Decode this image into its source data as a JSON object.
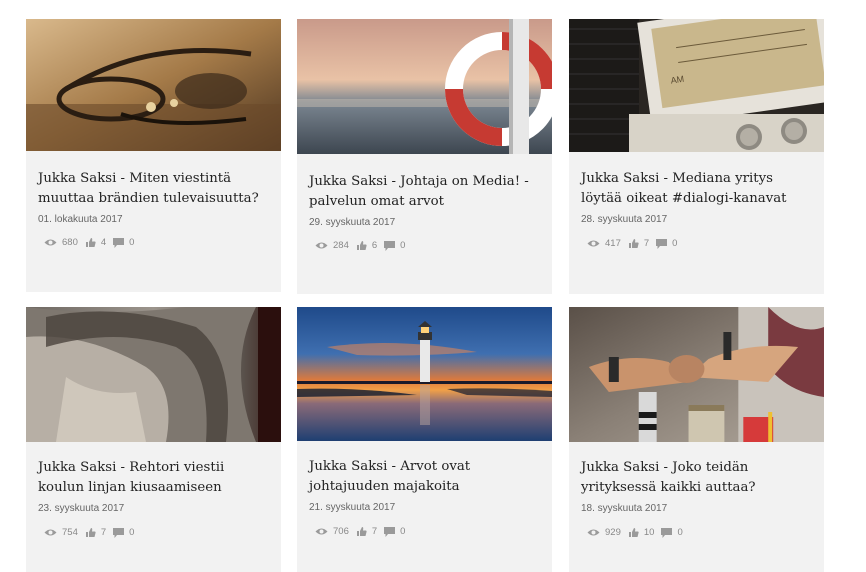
{
  "cards": [
    {
      "title": "Jukka Saksi - Miten viestintä muuttaa brändien tulevaisuutta?",
      "date": "01. lokakuuta 2017",
      "views": "680",
      "likes": "4",
      "comments": "0",
      "image": "sunglasses-photo"
    },
    {
      "title": "Jukka Saksi - Johtaja on Media! - palvelun omat arvot",
      "date": "29. syyskuuta 2017",
      "views": "284",
      "likes": "6",
      "comments": "0",
      "image": "lifebuoy-photo"
    },
    {
      "title": "Jukka Saksi - Mediana yritys löytää oikeat #dialogi-kanavat",
      "date": "28. syyskuuta 2017",
      "views": "417",
      "likes": "7",
      "comments": "0",
      "image": "radio-photo"
    },
    {
      "title": "Jukka Saksi - Rehtori viestii koulun linjan kiusaamiseen",
      "date": "23. syyskuuta 2017",
      "views": "754",
      "likes": "7",
      "comments": "0",
      "image": "sad-person-photo"
    },
    {
      "title": "Jukka Saksi - Arvot ovat johtajuuden majakoita",
      "date": "21. syyskuuta 2017",
      "views": "706",
      "likes": "7",
      "comments": "0",
      "image": "lighthouse-photo"
    },
    {
      "title": "Jukka Saksi - Joko teidän yrityksessä kaikki auttaa?",
      "date": "18. syyskuuta 2017",
      "views": "929",
      "likes": "10",
      "comments": "0",
      "image": "fist-bump-photo"
    }
  ],
  "colors": {
    "card_bg": "#f2f2f2",
    "title": "#222222",
    "meta": "#888888"
  },
  "icons": {
    "views": "eye-icon",
    "likes": "thumbs-up-icon",
    "comments": "comment-icon"
  }
}
